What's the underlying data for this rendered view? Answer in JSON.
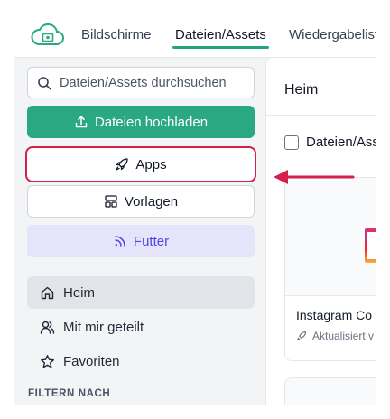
{
  "header": {
    "tabs": [
      {
        "label": "Bildschirme"
      },
      {
        "label": "Dateien/Assets",
        "active": true
      },
      {
        "label": "Wiedergabelist"
      }
    ]
  },
  "sidebar": {
    "search": {
      "placeholder": "Dateien/Assets durchsuchen"
    },
    "upload_label": "Dateien hochladen",
    "apps_label": "Apps",
    "templates_label": "Vorlagen",
    "feed_label": "Futter",
    "nav": {
      "home": "Heim",
      "shared": "Mit mir geteilt",
      "favorites": "Favoriten"
    },
    "filter_heading": "FILTERN NACH"
  },
  "main": {
    "title": "Heim",
    "select_label": "Dateien/Ass",
    "card": {
      "title": "Instagram Co",
      "meta": "Aktualisiert v"
    }
  },
  "colors": {
    "accent": "#2aa882",
    "highlight": "#d3204c",
    "feed": "#4f46e5"
  }
}
